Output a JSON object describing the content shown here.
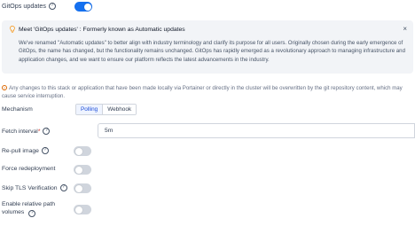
{
  "gitops": {
    "label": "GitOps updates",
    "help": "?",
    "enabled": true
  },
  "banner": {
    "title": "Meet 'GitOps updates' : Formerly known as Automatic updates",
    "close": "×",
    "body": "We've renamed \"Automatic updates\" to better align with industry terminology and clarify its purpose for all users. Originally chosen during the early emergence of GitOps, the name has changed, but the functionality remains unchanged. GitOps has rapidly emerged as a revolutionary approach to managing infrastructure and application changes, and we want to ensure our platform reflects the latest advancements in the industry."
  },
  "warning": {
    "icon": "!",
    "text": "Any changes to this stack or application that have been made locally via Portainer or directly in the cluster will be overwritten by the git repository content, which may cause service interruption."
  },
  "mechanism": {
    "label": "Mechanism",
    "options": [
      "Polling",
      "Webhook"
    ],
    "selected": "Polling"
  },
  "fetch_interval": {
    "label": "Fetch interval",
    "required_mark": "*",
    "help": "?",
    "value": "5m"
  },
  "toggles": {
    "repull_image": {
      "label": "Re-pull image",
      "help": "?",
      "enabled": false
    },
    "force_redeployment": {
      "label": "Force redeployment",
      "enabled": false
    },
    "skip_tls": {
      "label": "Skip TLS Verification",
      "help": "?",
      "enabled": false
    },
    "relative_paths": {
      "label": "Enable relative path volumes",
      "help": "?",
      "enabled": false
    }
  },
  "colors": {
    "accent": "#1570ef",
    "toggle_off": "#d0d5dd",
    "banner_bg": "#f2f4f7",
    "warning": "#dc6803"
  },
  "icons": [
    "help-circle-icon",
    "lightbulb-icon",
    "close-icon",
    "alert-circle-icon"
  ]
}
